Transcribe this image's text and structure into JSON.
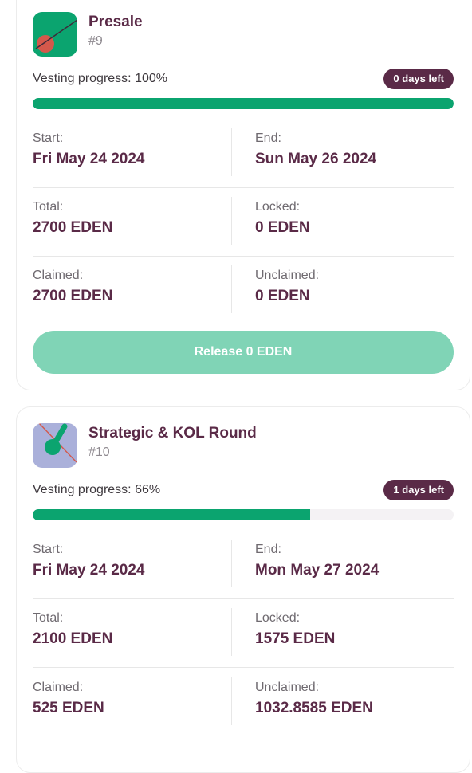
{
  "vestings": [
    {
      "name": "Presale",
      "id": "#9",
      "progress_label": "Vesting progress: 100%",
      "progress_fraction": 1.0,
      "days_left": "0 days left",
      "start_label": "Start:",
      "start_value": "Fri May 24 2024",
      "end_label": "End:",
      "end_value": "Sun May 26 2024",
      "total_label": "Total:",
      "total_value": "2700 EDEN",
      "locked_label": "Locked:",
      "locked_value": "0 EDEN",
      "claimed_label": "Claimed:",
      "claimed_value": "2700 EDEN",
      "unclaimed_label": "Unclaimed:",
      "unclaimed_value": "0 EDEN",
      "release_label": "Release 0 EDEN",
      "avatar_bg": "#0ba46f",
      "avatar_accent": "#d4584b"
    },
    {
      "name": "Strategic & KOL Round",
      "id": "#10",
      "progress_label": "Vesting progress: 66%",
      "progress_fraction": 0.66,
      "days_left": "1 days left",
      "start_label": "Start:",
      "start_value": "Fri May 24 2024",
      "end_label": "End:",
      "end_value": "Mon May 27 2024",
      "total_label": "Total:",
      "total_value": "2100 EDEN",
      "locked_label": "Locked:",
      "locked_value": "1575 EDEN",
      "claimed_label": "Claimed:",
      "claimed_value": "525 EDEN",
      "unclaimed_label": "Unclaimed:",
      "unclaimed_value": "1032.8585 EDEN",
      "avatar_bg": "#aab0da",
      "avatar_accent": "#0ba46f"
    }
  ]
}
